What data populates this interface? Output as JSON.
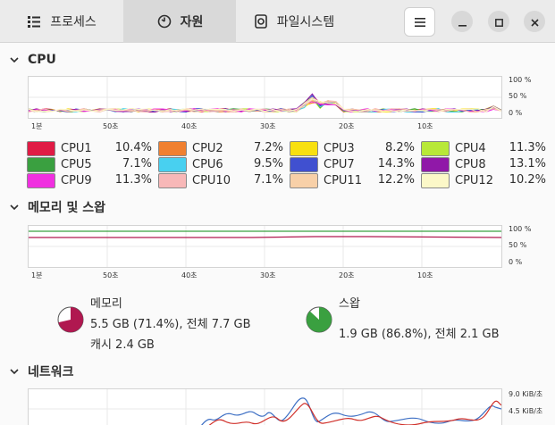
{
  "tabs": [
    {
      "label": "프로세스",
      "icon": "list-icon"
    },
    {
      "label": "자원",
      "icon": "gauge-icon",
      "active": true
    },
    {
      "label": "파일시스템",
      "icon": "disk-icon"
    }
  ],
  "sections": {
    "cpu": "CPU",
    "memory": "메모리 및 스왑",
    "network": "네트워크"
  },
  "time_labels": [
    "1분",
    "50초",
    "40초",
    "30초",
    "20초",
    "10초"
  ],
  "percent_labels": [
    "100 %",
    "50 %",
    "0 %"
  ],
  "network_labels": [
    "9.0 KiB/초",
    "4.5 KiB/초"
  ],
  "cpus": [
    {
      "name": "CPU1",
      "value": "10.4%",
      "color": "#e01b45"
    },
    {
      "name": "CPU2",
      "value": "7.2%",
      "color": "#f08030"
    },
    {
      "name": "CPU3",
      "value": "8.2%",
      "color": "#f8e010"
    },
    {
      "name": "CPU4",
      "value": "11.3%",
      "color": "#b8e838"
    },
    {
      "name": "CPU5",
      "value": "7.1%",
      "color": "#3aa040"
    },
    {
      "name": "CPU6",
      "value": "9.5%",
      "color": "#48d0f0"
    },
    {
      "name": "CPU7",
      "value": "14.3%",
      "color": "#4050d0"
    },
    {
      "name": "CPU8",
      "value": "13.1%",
      "color": "#9018a8"
    },
    {
      "name": "CPU9",
      "value": "11.3%",
      "color": "#f030e0"
    },
    {
      "name": "CPU10",
      "value": "7.1%",
      "color": "#f8b8b8"
    },
    {
      "name": "CPU11",
      "value": "12.2%",
      "color": "#f8d0a8"
    },
    {
      "name": "CPU12",
      "value": "10.2%",
      "color": "#fcf8c8"
    }
  ],
  "memory": {
    "title": "메모리",
    "usage": "5.5 GB (71.4%), 전체 7.7 GB",
    "cache": "캐시 2.4 GB",
    "fraction": 0.714,
    "color": "#b01850"
  },
  "swap": {
    "title": "스왑",
    "usage": "1.9 GB (86.8%), 전체 2.1 GB",
    "fraction": 0.868,
    "color": "#3aa040"
  }
}
